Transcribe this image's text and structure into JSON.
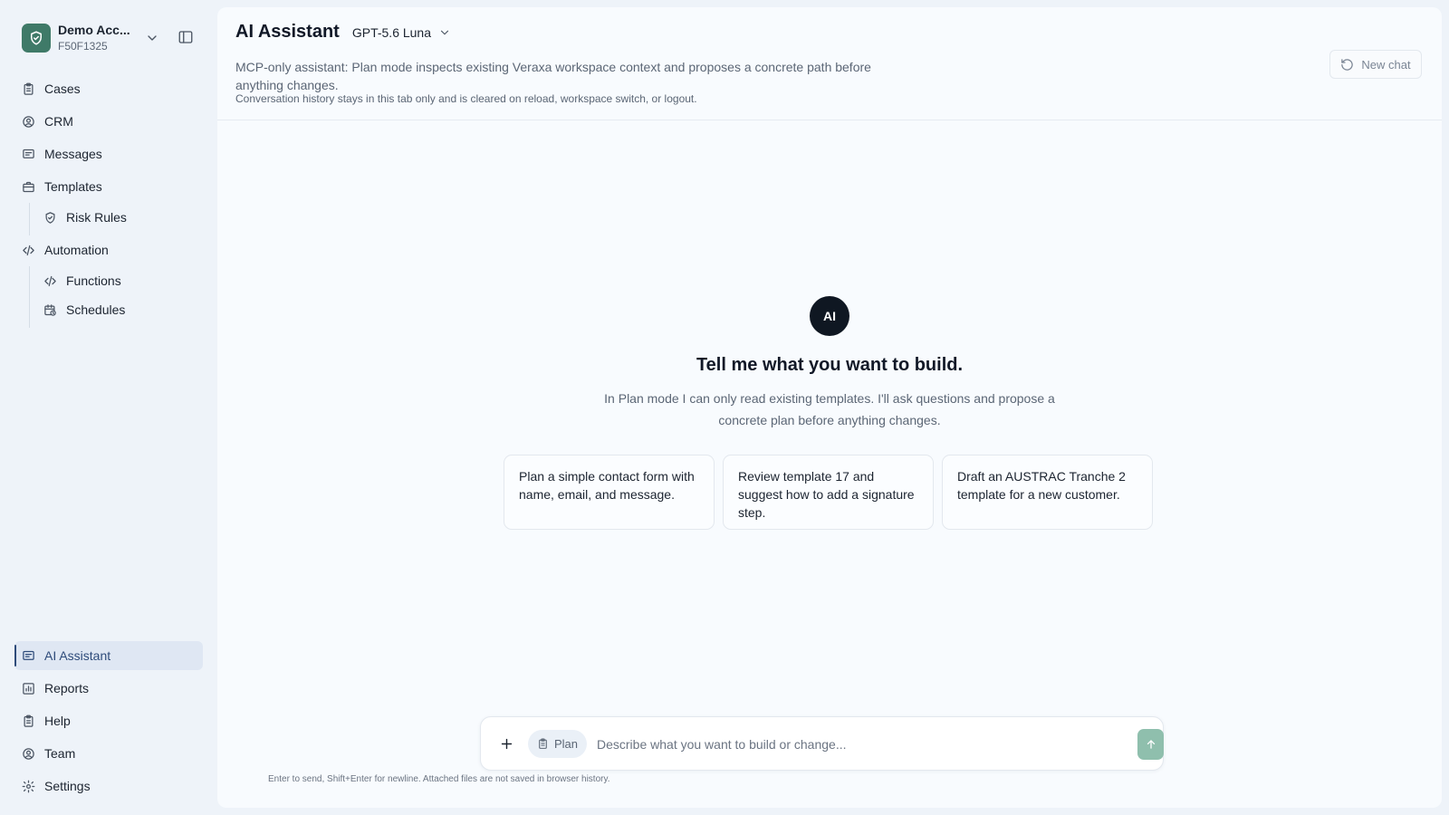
{
  "account": {
    "name": "Demo Acc...",
    "id": "F50F1325"
  },
  "sidebar": {
    "items": [
      {
        "label": "Cases",
        "icon": "clipboard-icon"
      },
      {
        "label": "CRM",
        "icon": "user-circle-icon"
      },
      {
        "label": "Messages",
        "icon": "message-icon"
      },
      {
        "label": "Templates",
        "icon": "briefcase-icon"
      },
      {
        "label": "Risk Rules",
        "icon": "shield-icon"
      },
      {
        "label": "Automation",
        "icon": "code-icon"
      },
      {
        "label": "Functions",
        "icon": "code-icon"
      },
      {
        "label": "Schedules",
        "icon": "calendar-clock-icon"
      }
    ],
    "bottom_items": [
      {
        "label": "AI Assistant",
        "icon": "message-icon",
        "active": true
      },
      {
        "label": "Reports",
        "icon": "bar-chart-icon"
      },
      {
        "label": "Help",
        "icon": "clipboard-icon"
      },
      {
        "label": "Team",
        "icon": "user-circle-icon"
      },
      {
        "label": "Settings",
        "icon": "gear-icon"
      }
    ]
  },
  "header": {
    "title": "AI Assistant",
    "model": "GPT-5.6 Luna",
    "description": "MCP-only assistant: Plan mode inspects existing Veraxa workspace context and proposes a concrete path before anything changes.",
    "note": "Conversation history stays in this tab only and is cleared on reload, workspace switch, or logout.",
    "new_chat_label": "New chat"
  },
  "empty_state": {
    "avatar_label": "AI",
    "title": "Tell me what you want to build.",
    "subtitle": "In Plan mode I can only read existing templates. I'll ask questions and propose a concrete plan before anything changes.",
    "suggestions": [
      "Plan a simple contact form with name, email, and message.",
      "Review template 17 and suggest how to add a signature step.",
      "Draft an AUSTRAC Tranche 2 template for a new customer."
    ]
  },
  "composer": {
    "mode_label": "Plan",
    "placeholder": "Describe what you want to build or change...",
    "hint": "Enter to send, Shift+Enter for newline. Attached files are not saved in browser history."
  },
  "colors": {
    "brand": "#3f7a68",
    "active_nav": "#2e4b7a",
    "send_button": "#8fbfad",
    "avatar": "#0f1722"
  }
}
